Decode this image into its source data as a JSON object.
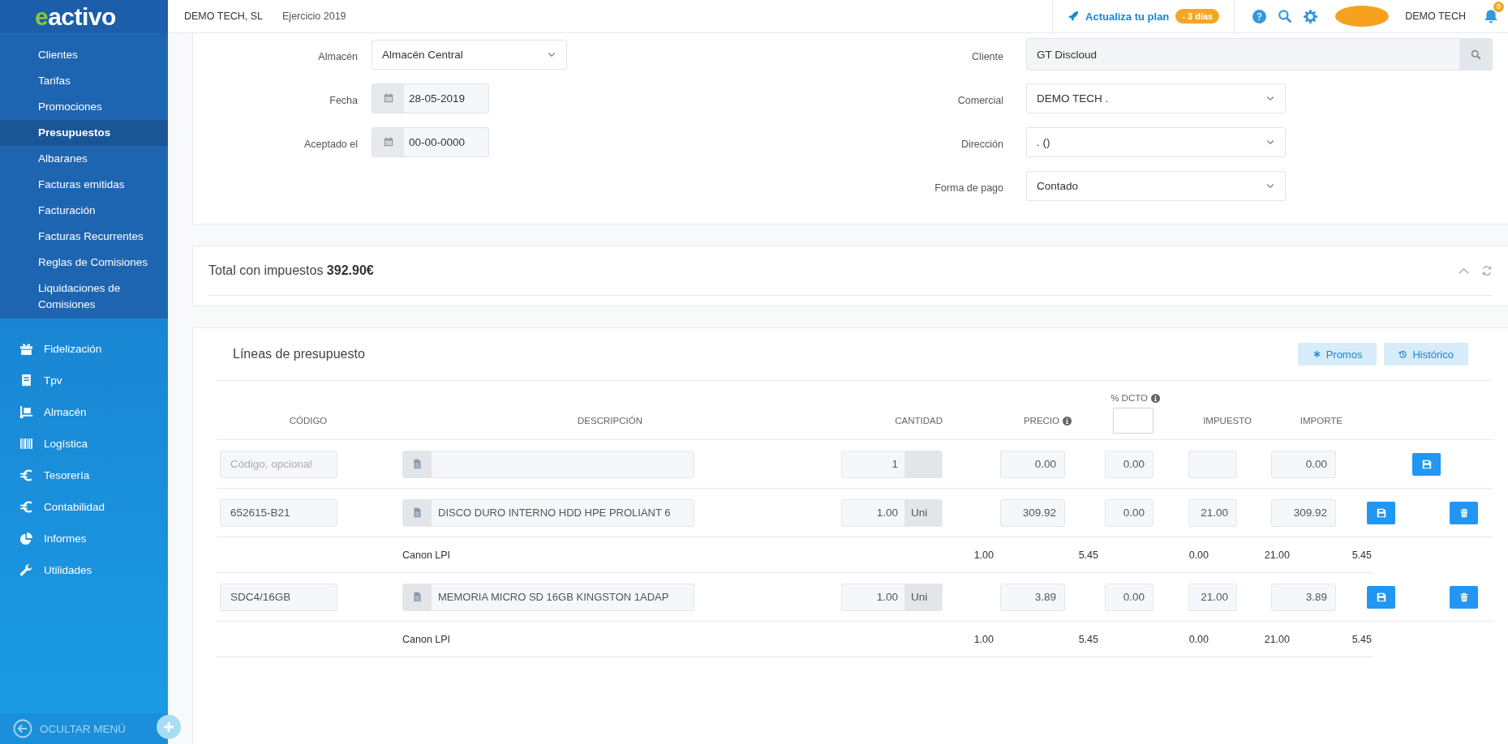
{
  "sidebar": {
    "logo": "eactivo",
    "submenu": [
      {
        "label": "Clientes",
        "selected": false
      },
      {
        "label": "Tarifas",
        "selected": false
      },
      {
        "label": "Promociones",
        "selected": false
      },
      {
        "label": "Presupuestos",
        "selected": true
      },
      {
        "label": "Albaranes",
        "selected": false
      },
      {
        "label": "Facturas emitidas",
        "selected": false
      },
      {
        "label": "Facturación",
        "selected": false
      },
      {
        "label": "Facturas Recurrentes",
        "selected": false
      },
      {
        "label": "Reglas de Comisiones",
        "selected": false
      },
      {
        "label": "Liquidaciones de Comisiones",
        "selected": false
      }
    ],
    "menu": [
      {
        "kind": "gift",
        "label": "Fidelización"
      },
      {
        "kind": "receipt",
        "label": "Tpv"
      },
      {
        "kind": "dolly",
        "label": "Almacén"
      },
      {
        "kind": "barcode",
        "label": "Logística"
      },
      {
        "kind": "euro",
        "label": "Tesorería"
      },
      {
        "kind": "euro",
        "label": "Contabilidad"
      },
      {
        "kind": "pie",
        "label": "Informes"
      },
      {
        "kind": "wrench",
        "label": "Utilidades"
      }
    ],
    "footer": "OCULTAR MENÚ"
  },
  "topbar": {
    "company": "DEMO TECH, SL",
    "fiscal_year": "Ejercicio 2019",
    "upgrade_link": "Actualiza tu plan",
    "trial_badge": "- 3 días",
    "user": "DEMO TECH",
    "notification_count": "0"
  },
  "form": {
    "left": [
      {
        "kind": "select",
        "label": "Almacén",
        "value": "Almacén Central"
      },
      {
        "kind": "date",
        "label": "Fecha",
        "value": "28-05-2019"
      },
      {
        "kind": "date",
        "label": "Aceptado el",
        "value": "00-00-0000"
      }
    ],
    "right": [
      {
        "kind": "search",
        "label": "Cliente",
        "value": "GT Discloud"
      },
      {
        "kind": "select",
        "label": "Comercial",
        "value": "DEMO TECH ."
      },
      {
        "kind": "select",
        "label": "Dirección",
        "value": ". ()"
      },
      {
        "kind": "select",
        "label": "Forma de pago",
        "value": "Contado"
      }
    ]
  },
  "total": {
    "text": "Total con impuestos **392.90€**"
  },
  "lines": {
    "title": "Líneas de presupuesto",
    "buttons": [
      {
        "kind": "promos",
        "label": "Promos"
      },
      {
        "kind": "history",
        "label": "Histórico"
      }
    ],
    "columns": [
      {
        "label": "CÓDIGO",
        "kind": "plain"
      },
      {
        "label": "DESCRIPCIÓN",
        "kind": "plain"
      },
      {
        "label": "CANTIDAD",
        "kind": "plain"
      },
      {
        "label": "PRECIO",
        "kind": "info"
      },
      {
        "label": "% DCTO",
        "kind": "filter"
      },
      {
        "label": "IMPUESTO",
        "kind": "plain"
      },
      {
        "label": "IMPORTE",
        "kind": "plain"
      }
    ],
    "rows": [
      {
        "kind": "new",
        "code_placeholder": "Código, opcional",
        "quantity": "1",
        "price": "0.00",
        "discount": "0.00",
        "amount": "0.00"
      },
      {
        "kind": "item",
        "code": "652615-B21",
        "description": "DISCO DURO INTERNO HDD HPE PROLIANT 6",
        "quantity": "1.00",
        "unit": "Uni",
        "price": "309.92",
        "discount": "0.00",
        "tax": "21.00",
        "amount": "309.92"
      },
      {
        "kind": "fee",
        "description": "Canon LPI",
        "quantity": "1.00",
        "price": "5.45",
        "discount": "0.00",
        "tax": "21.00",
        "amount": "5.45"
      },
      {
        "kind": "item",
        "code": "SDC4/16GB",
        "description": "MEMORIA MICRO SD 16GB KINGSTON 1ADAP",
        "quantity": "1.00",
        "unit": "Uni",
        "price": "3.89",
        "discount": "0.00",
        "tax": "21.00",
        "amount": "3.89"
      },
      {
        "kind": "fee",
        "description": "Canon LPI",
        "quantity": "1.00",
        "price": "5.45",
        "discount": "0.00",
        "tax": "21.00",
        "amount": "5.45"
      }
    ]
  }
}
